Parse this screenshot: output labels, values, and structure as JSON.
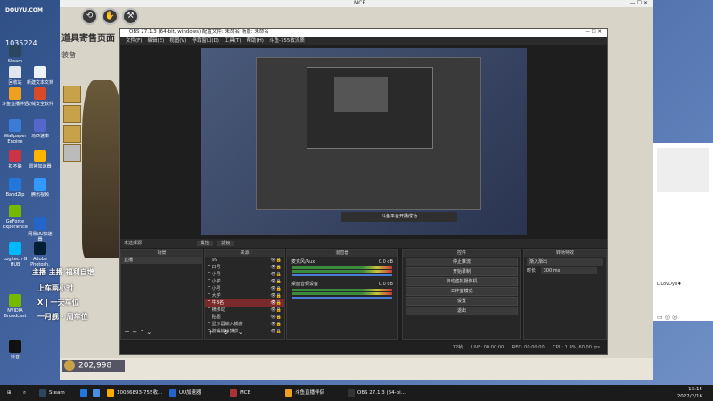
{
  "desktop": {
    "logo_top": "DOUYU.COM",
    "room_id": "1035224",
    "icons": [
      {
        "label": "Steam",
        "color": "#2a475e"
      },
      {
        "label": "回收站",
        "color": "#dfe6ef"
      },
      {
        "label": "新建文本文档",
        "color": "#eef2f6"
      },
      {
        "label": "斗鱼直播伴侣",
        "color": "#f0a020"
      },
      {
        "label": "火绒安全软件",
        "color": "#d94a2a"
      },
      {
        "label": "Wallpaper Engine",
        "color": "#3a7bd5"
      },
      {
        "label": "马匹速率",
        "color": "#5566cc"
      },
      {
        "label": "扣不确",
        "color": "#cc3344"
      },
      {
        "label": "雷神加速器",
        "color": "#ffb400"
      },
      {
        "label": "BandZip",
        "color": "#2277dd"
      },
      {
        "label": "腾讯视频",
        "color": "#3399ff"
      },
      {
        "label": "GeForce Experience",
        "color": "#76b900"
      },
      {
        "label": "网易UU加速器",
        "color": "#2266cc"
      },
      {
        "label": "Logitech G HUB",
        "color": "#00b8fc"
      },
      {
        "label": "Adobe Photosh.",
        "color": "#001e36"
      },
      {
        "label": "NVIDIA Broadcast",
        "color": "#76b900"
      },
      {
        "label": "抖音",
        "color": "#111111"
      }
    ]
  },
  "game": {
    "window_title": "MCE",
    "title": "道具寄售页面",
    "tab": "装备",
    "coins": "202,998",
    "buttons": [
      "⟲",
      "✋",
      "⚒",
      "⚒"
    ]
  },
  "obs": {
    "title": "OBS 27.1.3 (64-bit, windows)  配置文件: 未命名  场景: 未命名",
    "menu": [
      "文件(F)",
      "编辑(E)",
      "视图(V)",
      "停靠窗口(D)",
      "工具(T)",
      "帮助(H)",
      "斗鱼-755收流质"
    ],
    "toast": "斗鱼平台开播成功",
    "source_bar": "未选择源",
    "source_tabs": [
      "属性",
      "滤镜"
    ],
    "panels": {
      "scenes": {
        "header": "场景",
        "items": [
          "直播"
        ]
      },
      "sources": {
        "header": "来源",
        "items": [
          "99",
          "口号",
          "小号",
          "小学",
          "小号",
          "大学",
          "牛B名",
          "横移动",
          "贴图",
          "显示器输入捕获",
          "游戏输出捕获"
        ]
      },
      "mixer": {
        "header": "混音器",
        "channels": [
          {
            "name": "麦克风/Aux",
            "level": "0.0 dB"
          },
          {
            "name": "桌面音频设备",
            "level": "0.0 dB"
          }
        ]
      },
      "controls": {
        "header": "控件",
        "buttons": [
          "停止推流",
          "开始录制",
          "启动虚拟摄像机",
          "工作室模式",
          "设置",
          "退出"
        ]
      },
      "transitions": {
        "header": "转场特效",
        "selected": "渐入渐出",
        "duration_label": "时长",
        "duration_value": "300 ms"
      }
    },
    "status": {
      "live": "LIVE: 00:00:00",
      "rec": "REC: 00:00:00",
      "cpu": "CPU: 1.9%, 60.00 fps",
      "dropped": "12帧"
    }
  },
  "overlay": {
    "line1": "主播 主播 福利自增",
    "line2": "上车两小时",
    "line3": "X | 一天车位",
    "line4": "一月舰 · 周车位"
  },
  "chat": {
    "name": "L LovDyu♦"
  },
  "taskbar": {
    "items": [
      {
        "label": "Steam",
        "color": "#2a475e"
      },
      {
        "label": "",
        "color": "#2277dd"
      },
      {
        "label": "",
        "color": "#4a90e2"
      },
      {
        "label": "10086893-755收...",
        "color": "#ffaa00"
      },
      {
        "label": "UU加速器",
        "color": "#2266cc"
      },
      {
        "label": "MCE",
        "color": "#aa3333"
      },
      {
        "label": "斗鱼直播伴侣",
        "color": "#f0a020"
      },
      {
        "label": "OBS 27.1.3 (64-bi...",
        "color": "#333333"
      }
    ],
    "time": "13:15",
    "date": "2022/2/16"
  }
}
